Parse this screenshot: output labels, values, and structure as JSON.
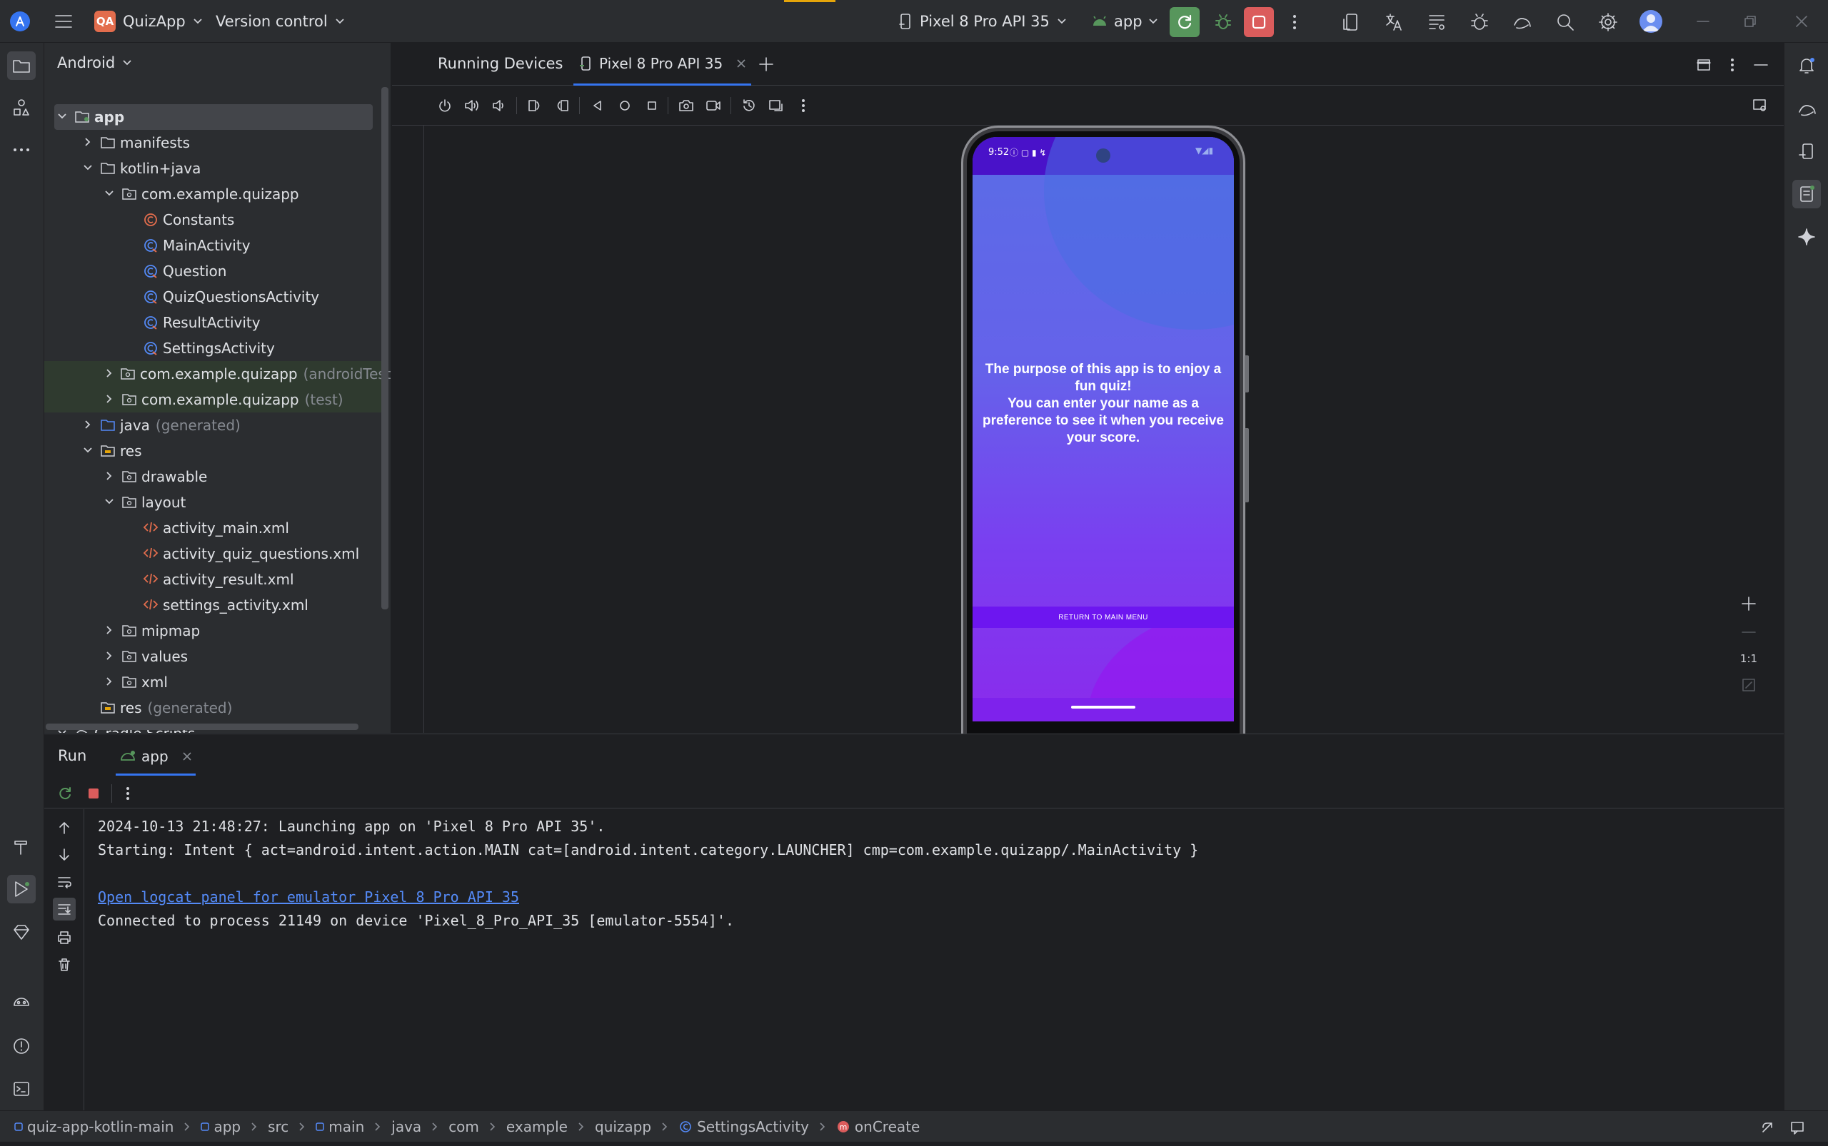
{
  "titlebar": {
    "project_badge": "QA",
    "project_name": "QuizApp",
    "vcs": "Version control",
    "device": "Pixel 8 Pro API 35",
    "run_config": "app"
  },
  "project_panel": {
    "view": "Android",
    "items": [
      {
        "label": "app",
        "extra": ""
      },
      {
        "label": "manifests",
        "extra": ""
      },
      {
        "label": "kotlin+java",
        "extra": ""
      },
      {
        "label": "com.example.quizapp",
        "extra": ""
      },
      {
        "label": "Constants",
        "extra": ""
      },
      {
        "label": "MainActivity",
        "extra": ""
      },
      {
        "label": "Question",
        "extra": ""
      },
      {
        "label": "QuizQuestionsActivity",
        "extra": ""
      },
      {
        "label": "ResultActivity",
        "extra": ""
      },
      {
        "label": "SettingsActivity",
        "extra": ""
      },
      {
        "label": "com.example.quizapp",
        "extra": "(androidTest)"
      },
      {
        "label": "com.example.quizapp",
        "extra": "(test)"
      },
      {
        "label": "java",
        "extra": "(generated)"
      },
      {
        "label": "res",
        "extra": ""
      },
      {
        "label": "drawable",
        "extra": ""
      },
      {
        "label": "layout",
        "extra": ""
      },
      {
        "label": "activity_main.xml",
        "extra": ""
      },
      {
        "label": "activity_quiz_questions.xml",
        "extra": ""
      },
      {
        "label": "activity_result.xml",
        "extra": ""
      },
      {
        "label": "settings_activity.xml",
        "extra": ""
      },
      {
        "label": "mipmap",
        "extra": ""
      },
      {
        "label": "values",
        "extra": ""
      },
      {
        "label": "xml",
        "extra": ""
      },
      {
        "label": "res",
        "extra": "(generated)"
      },
      {
        "label": "Gradle Scripts",
        "extra": ""
      }
    ]
  },
  "devices_panel": {
    "title": "Running Devices",
    "tab": "Pixel 8 Pro API 35",
    "zoom_label": "1:1"
  },
  "phone": {
    "time": "9:52",
    "message": "The purpose of this app is to enjoy a fun quiz!\nYou can enter your name as a preference to see it when you receive your score.",
    "button": "RETURN TO MAIN MENU"
  },
  "run_panel": {
    "tab_run": "Run",
    "tab_app": "app",
    "lines": [
      "2024-10-13 21:48:27: Launching app on 'Pixel 8 Pro API 35'.",
      "Starting: Intent { act=android.intent.action.MAIN cat=[android.intent.category.LAUNCHER] cmp=com.example.quizapp/.MainActivity }",
      "",
      "Open logcat panel for emulator Pixel 8 Pro API 35",
      "Connected to process 21149 on device 'Pixel_8_Pro_API_35 [emulator-5554]'."
    ]
  },
  "breadcrumbs": [
    "quiz-app-kotlin-main",
    "app",
    "src",
    "main",
    "java",
    "com",
    "example",
    "quizapp",
    "SettingsActivity",
    "onCreate"
  ],
  "colors": {
    "accent_green": "#57965c",
    "stop_red": "#db5c5c",
    "phone_top": "#5868e0",
    "phone_bottom": "#8a2bec",
    "phone_button": "#6d16f0",
    "link": "#548af7"
  }
}
